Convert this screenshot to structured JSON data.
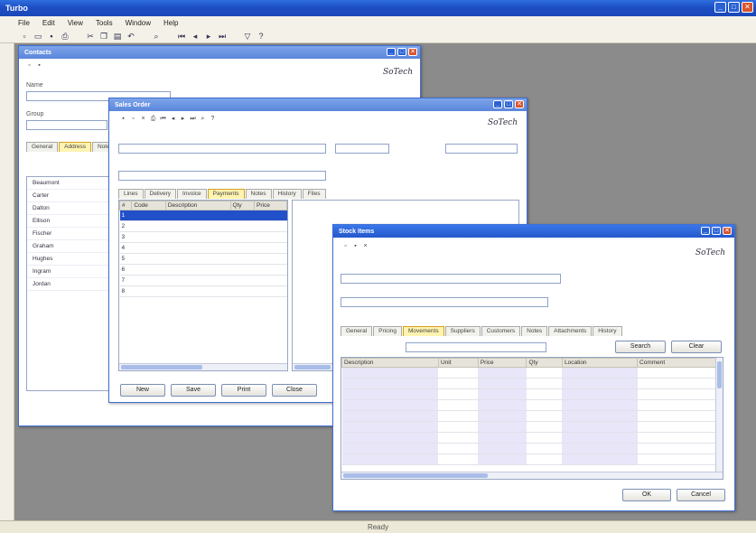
{
  "app": {
    "title": "Turbo",
    "menu": [
      "File",
      "Edit",
      "View",
      "Tools",
      "Window",
      "Help"
    ],
    "toolbar_icons": [
      "new-icon",
      "open-icon",
      "save-icon",
      "print-icon",
      "cut-icon",
      "copy-icon",
      "paste-icon",
      "undo-icon",
      "find-icon",
      "first-icon",
      "prev-icon",
      "next-icon",
      "last-icon",
      "filter-icon",
      "help-icon"
    ],
    "status": "Ready"
  },
  "brand": {
    "logo_text": "SoTech",
    "logo_accent": "#c02020"
  },
  "win_back": {
    "title": "Contacts",
    "label_1": "Name",
    "field_1": "",
    "label_2": "Group",
    "tabs": [
      "General",
      "Address",
      "Notes"
    ],
    "side_items": [
      "Beaumont",
      "Carter",
      "Dalton",
      "Ellison",
      "Fischer",
      "Graham",
      "Hughes",
      "Ingram",
      "Jordan"
    ]
  },
  "win_mid": {
    "title": "Sales Order",
    "field_a": "",
    "field_b": "",
    "field_c": "",
    "tabs": [
      "Lines",
      "Delivery",
      "Invoice",
      "Payments",
      "Notes",
      "History",
      "Files"
    ],
    "grid_headers": [
      "#",
      "Code",
      "Description",
      "Qty",
      "Price"
    ],
    "grid_rows": [
      [
        "1",
        "",
        "",
        "",
        ""
      ],
      [
        "2",
        "",
        "",
        "",
        ""
      ],
      [
        "3",
        "",
        "",
        "",
        ""
      ],
      [
        "4",
        "",
        "",
        "",
        ""
      ],
      [
        "5",
        "",
        "",
        "",
        ""
      ],
      [
        "6",
        "",
        "",
        "",
        ""
      ],
      [
        "7",
        "",
        "",
        "",
        ""
      ],
      [
        "8",
        "",
        "",
        "",
        ""
      ]
    ],
    "buttons": [
      "New",
      "Save",
      "Print",
      "Close"
    ]
  },
  "win_front": {
    "title": "Stock Items",
    "field_a": "",
    "field_b": "",
    "tabs": [
      "General",
      "Pricing",
      "Movements",
      "Suppliers",
      "Customers",
      "Notes",
      "Attachments",
      "History"
    ],
    "filter_value": "",
    "search_label": "Search",
    "clear_label": "Clear",
    "grid_headers": [
      "Description",
      "Unit",
      "Price",
      "Qty",
      "Location",
      "Comment"
    ],
    "grid_rows": [
      [
        "",
        "",
        "",
        "",
        "",
        ""
      ],
      [
        "",
        "",
        "",
        "",
        "",
        ""
      ],
      [
        "",
        "",
        "",
        "",
        "",
        ""
      ],
      [
        "",
        "",
        "",
        "",
        "",
        ""
      ],
      [
        "",
        "",
        "",
        "",
        "",
        ""
      ],
      [
        "",
        "",
        "",
        "",
        "",
        ""
      ],
      [
        "",
        "",
        "",
        "",
        "",
        ""
      ],
      [
        "",
        "",
        "",
        "",
        "",
        ""
      ],
      [
        "",
        "",
        "",
        "",
        "",
        ""
      ]
    ],
    "ok_label": "OK",
    "cancel_label": "Cancel"
  }
}
